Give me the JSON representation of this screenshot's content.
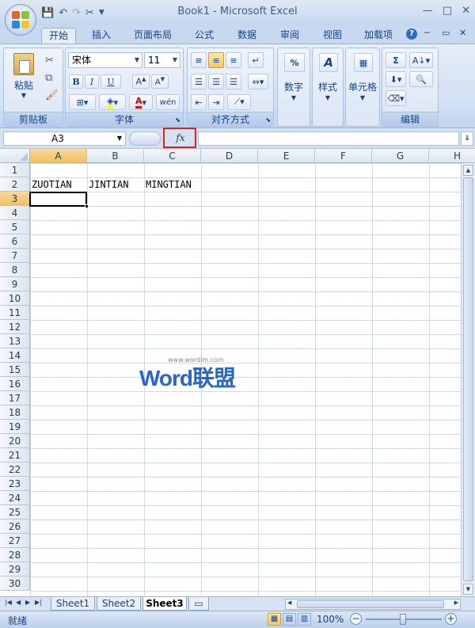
{
  "window": {
    "title": "Book1 - Microsoft Excel",
    "controls": [
      "—",
      "□",
      "✕"
    ]
  },
  "ribbon_tabs": [
    {
      "label": "开始",
      "active": true
    },
    {
      "label": "插入"
    },
    {
      "label": "页面布局"
    },
    {
      "label": "公式"
    },
    {
      "label": "数据"
    },
    {
      "label": "审阅"
    },
    {
      "label": "视图"
    },
    {
      "label": "加载项"
    }
  ],
  "groups": {
    "clipboard": {
      "label": "剪贴板",
      "paste": "粘贴"
    },
    "font": {
      "label": "字体",
      "font_name": "宋体",
      "font_size": "11",
      "bold": "B",
      "italic": "I",
      "underline": "U"
    },
    "alignment": {
      "label": "对齐方式"
    },
    "number": {
      "label": "数字",
      "icon": "%"
    },
    "styles": {
      "label": "样式"
    },
    "cells": {
      "label": "单元格"
    },
    "editing": {
      "label": "编辑",
      "sum": "Σ"
    }
  },
  "formula_bar": {
    "name_box": "A3",
    "fx": "fx",
    "content": ""
  },
  "sheet": {
    "columns": [
      "A",
      "B",
      "C",
      "D",
      "E",
      "F",
      "G",
      "H"
    ],
    "rows": [
      "1",
      "2",
      "3",
      "4",
      "5",
      "6",
      "7",
      "8",
      "9",
      "10",
      "11",
      "12",
      "13",
      "14",
      "15",
      "16",
      "17",
      "18",
      "19",
      "20",
      "21",
      "22",
      "23",
      "24",
      "25",
      "26",
      "27",
      "28",
      "29",
      "30"
    ],
    "active_cell": "A3",
    "cells": {
      "A2": "ZUOTIAN",
      "B2": "JINTIAN",
      "C2": "MINGTIAN"
    }
  },
  "watermark": {
    "text": "Word联盟",
    "url": "www.wordlm.com"
  },
  "sheet_tabs": [
    {
      "label": "Sheet1"
    },
    {
      "label": "Sheet2"
    },
    {
      "label": "Sheet3",
      "active": true
    }
  ],
  "status": {
    "ready": "就绪",
    "zoom": "100%"
  }
}
